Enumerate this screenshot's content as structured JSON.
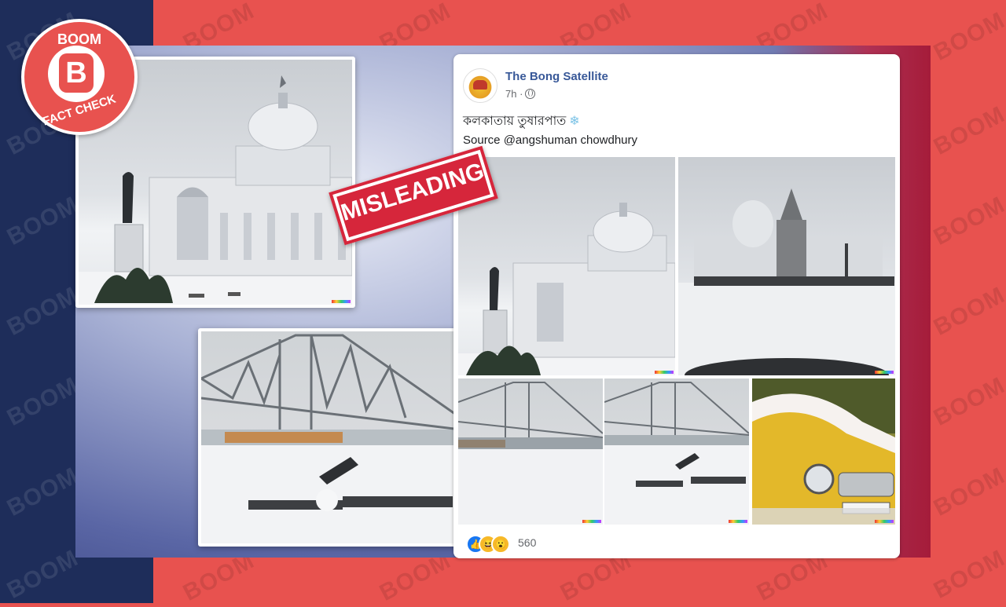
{
  "watermark": {
    "text": "BOOM"
  },
  "logo": {
    "top": "BOOM",
    "letter": "B",
    "bottom": "FACT CHECK"
  },
  "stamp": {
    "label": "MISLEADING"
  },
  "post": {
    "page_name": "The Bong Satellite",
    "time": "7h ·",
    "text_bengali": "কলকাতায় তুষারপাত",
    "source": "Source @angshuman chowdhury",
    "reaction_count": "560"
  },
  "icons": [
    "snowflake-icon",
    "globe-icon",
    "like-reaction-icon",
    "haha-reaction-icon",
    "wow-reaction-icon"
  ],
  "colors": {
    "brand_red": "#e8524f",
    "navy": "#1e2d5a",
    "stamp_red": "#d6263b",
    "fb_blue": "#385898"
  }
}
